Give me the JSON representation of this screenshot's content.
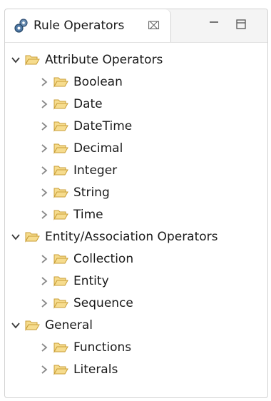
{
  "view": {
    "tab_title": "Rule Operators",
    "tab_icon": "gears-icon",
    "close_icon": "close-x-icon",
    "minimize_icon": "minimize-icon",
    "maximize_icon": "maximize-icon"
  },
  "colors": {
    "folder_fill": "#f6dc8e",
    "folder_stroke": "#c99e36",
    "chevron": "#8a8a8a",
    "chevron_expanded": "#3a3a3a"
  },
  "tree": [
    {
      "label": "Attribute Operators",
      "expanded": true,
      "children": [
        {
          "label": "Boolean"
        },
        {
          "label": "Date"
        },
        {
          "label": "DateTime"
        },
        {
          "label": "Decimal"
        },
        {
          "label": "Integer"
        },
        {
          "label": "String"
        },
        {
          "label": "Time"
        }
      ]
    },
    {
      "label": "Entity/Association Operators",
      "expanded": true,
      "children": [
        {
          "label": "Collection"
        },
        {
          "label": "Entity"
        },
        {
          "label": "Sequence"
        }
      ]
    },
    {
      "label": "General",
      "expanded": true,
      "children": [
        {
          "label": "Functions"
        },
        {
          "label": "Literals"
        }
      ]
    }
  ]
}
